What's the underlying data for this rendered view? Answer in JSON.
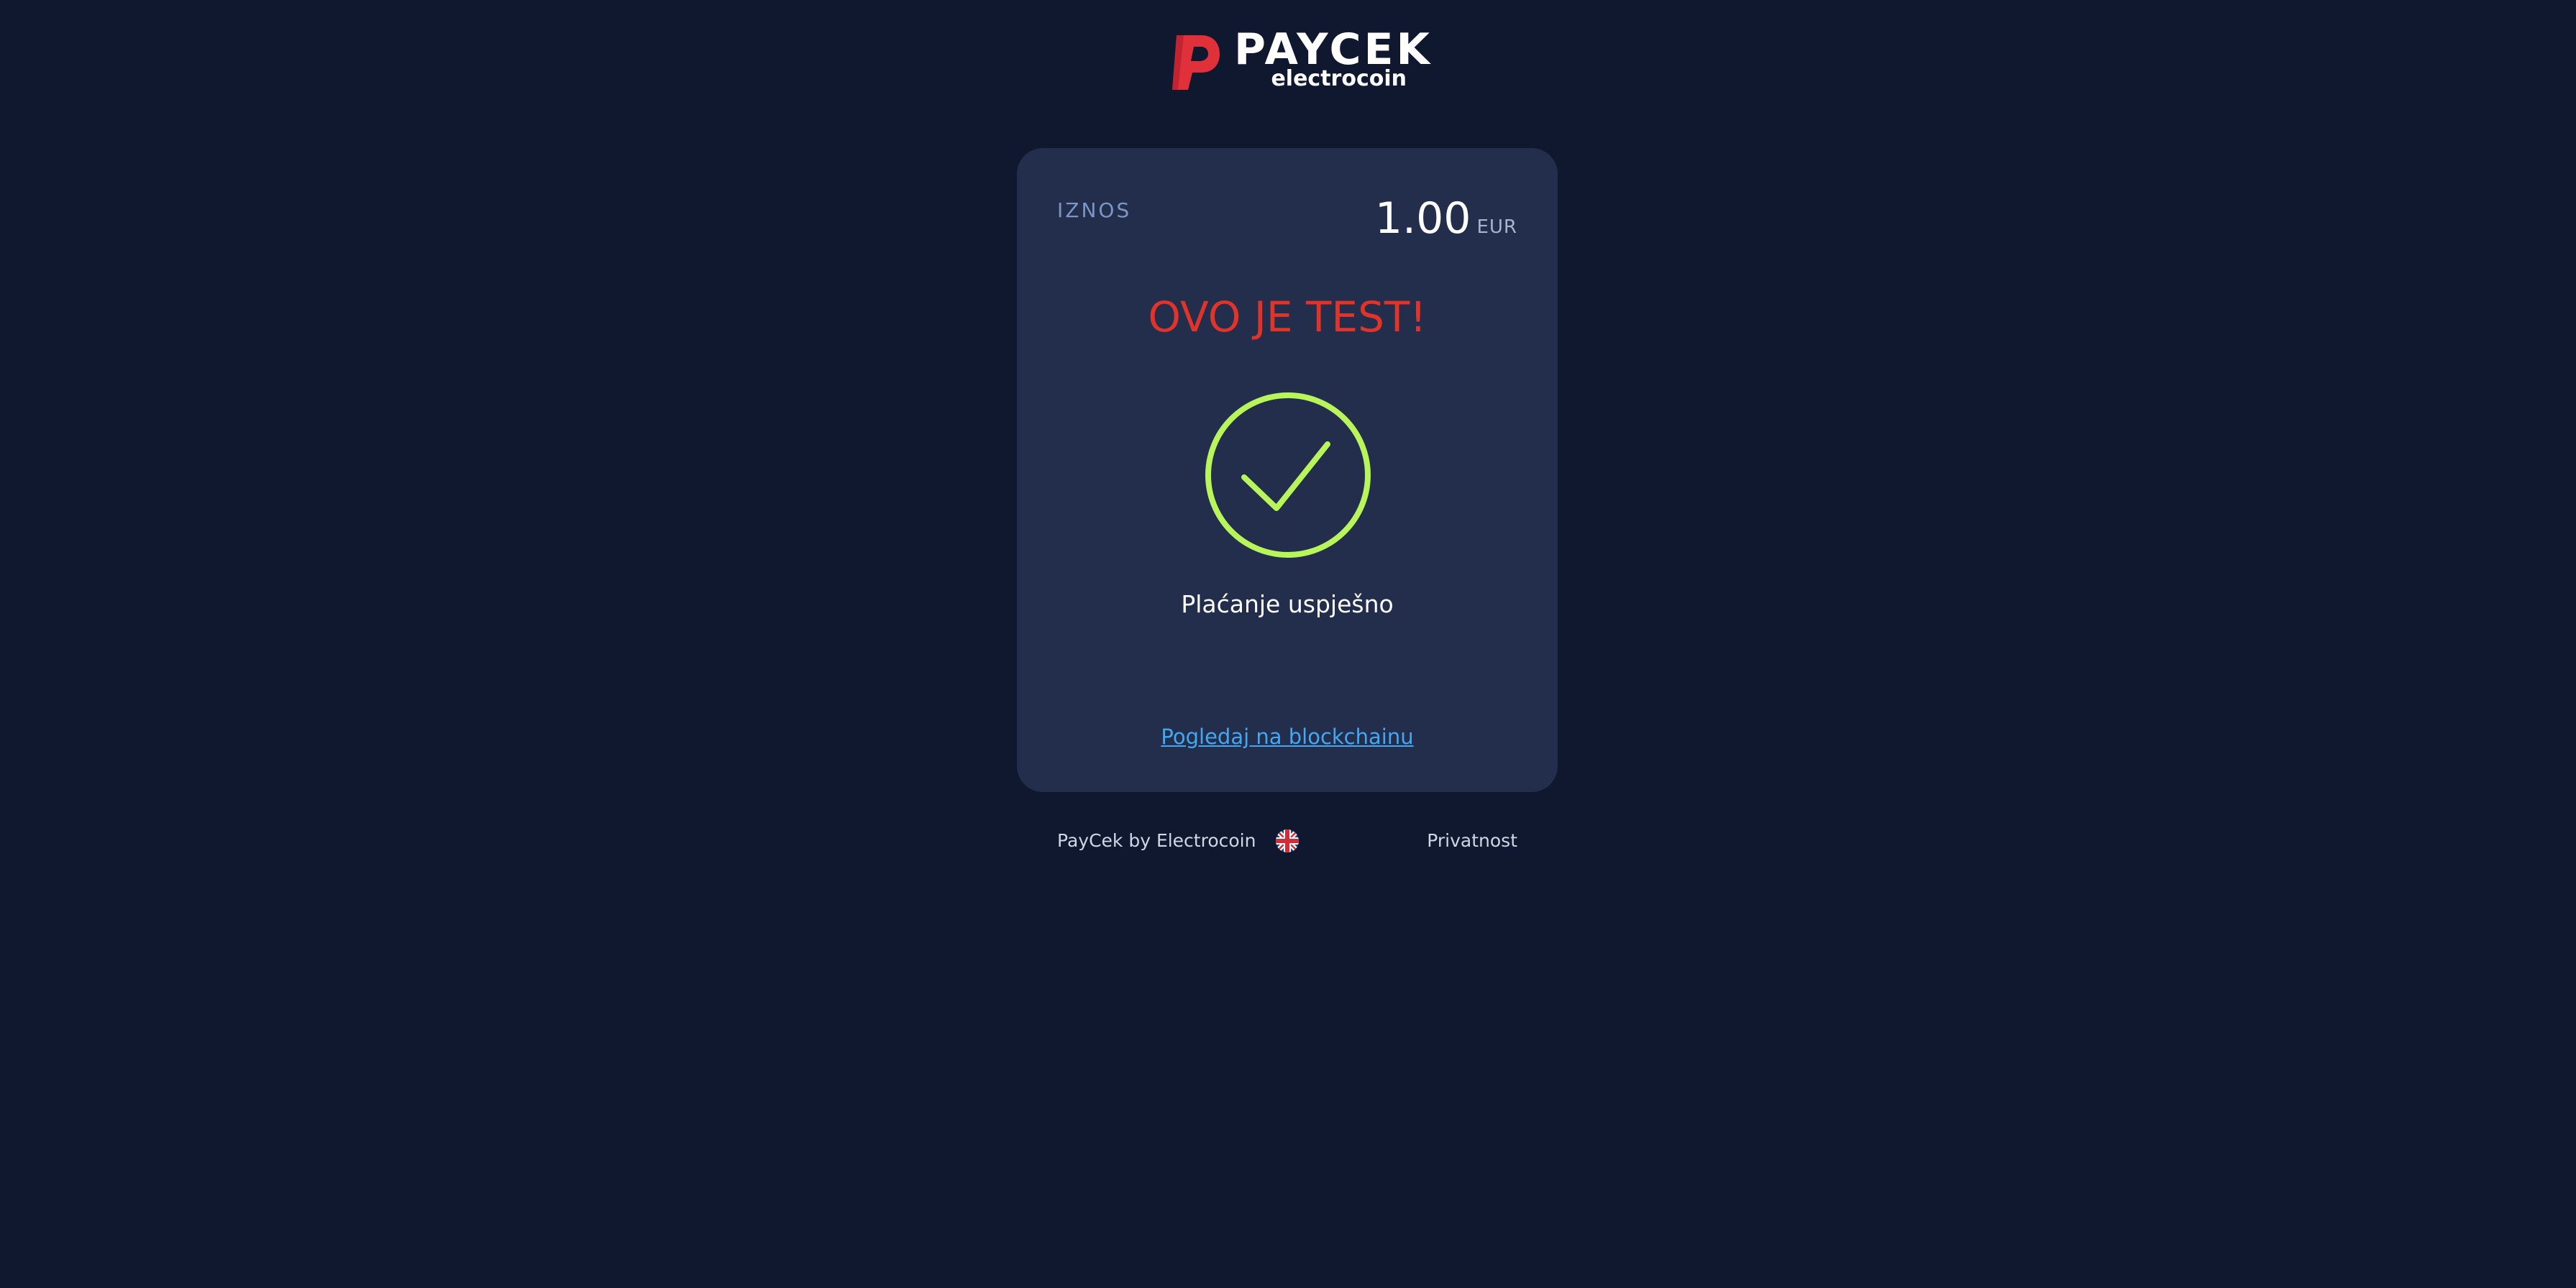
{
  "logo": {
    "wordmark": "PAYCEK",
    "tagline": "electrocoin",
    "mark_color": "#e0313a"
  },
  "card": {
    "amount_label": "IZNOS",
    "amount_value": "1.00",
    "currency": "EUR",
    "test_notice": "OVO JE TEST!",
    "status_icon": "check-circle-icon",
    "status_text": "Plaćanje uspješno",
    "blockchain_link": "Pogledaj na blockchainu"
  },
  "footer": {
    "brand": "PayCek by Electrocoin",
    "language_icon": "uk-flag-icon",
    "privacy": "Privatnost"
  },
  "colors": {
    "background": "#101830",
    "card": "#222e4c",
    "success": "#b8f55a",
    "warning": "#e0332a",
    "link": "#45a7f2"
  }
}
